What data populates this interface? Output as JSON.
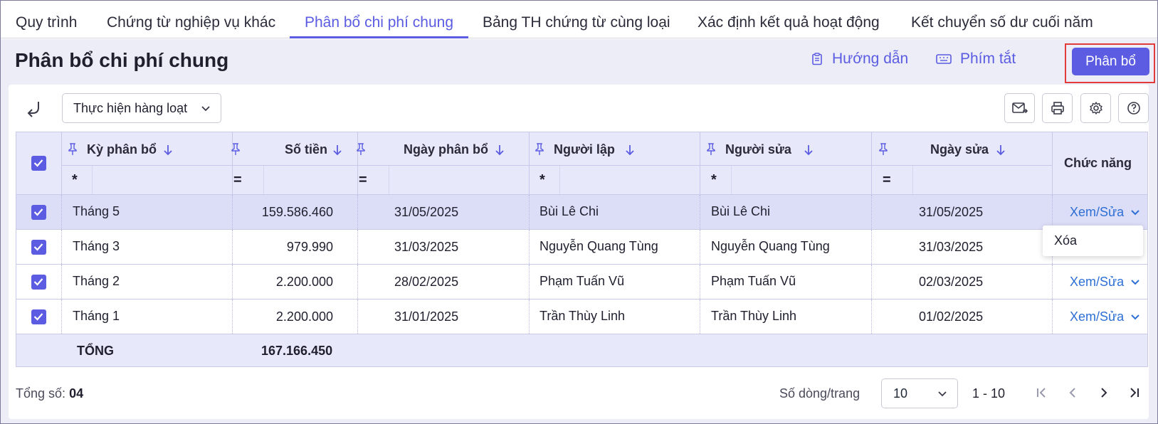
{
  "tabs": [
    {
      "label": "Quy trình",
      "active": false
    },
    {
      "label": "Chứng từ nghiệp vụ khác",
      "active": false
    },
    {
      "label": "Phân bổ chi phí chung",
      "active": true
    },
    {
      "label": "Bảng TH chứng từ cùng loại",
      "active": false
    },
    {
      "label": "Xác định kết quả hoạt động",
      "active": false
    },
    {
      "label": "Kết chuyển số dư cuối năm",
      "active": false
    }
  ],
  "header": {
    "title": "Phân bổ chi phí chung",
    "guide_label": "Hướng dẫn",
    "shortcut_label": "Phím tắt",
    "primary_label": "Phân bổ"
  },
  "toolbar": {
    "bulk_label": "Thực hiện hàng loạt"
  },
  "table": {
    "columns": [
      "Kỳ phân bổ",
      "Số tiền",
      "Ngày phân bổ",
      "Người lập",
      "Người sửa",
      "Ngày sửa",
      "Chức năng"
    ],
    "filter_ops": [
      "*",
      "=",
      "=",
      "*",
      "*",
      "="
    ],
    "rows": [
      {
        "period": "Tháng 5",
        "amount": "159.586.460",
        "alloc_date": "31/05/2025",
        "creator": "Bùi Lê Chi",
        "editor": "Bùi Lê Chi",
        "edit_date": "31/05/2025",
        "action": "Xem/Sửa",
        "checked": true,
        "selected": true
      },
      {
        "period": "Tháng 3",
        "amount": "979.990",
        "alloc_date": "31/03/2025",
        "creator": "Nguyễn Quang Tùng",
        "editor": "Nguyễn Quang Tùng",
        "edit_date": "31/03/2025",
        "action": "",
        "checked": true,
        "selected": false
      },
      {
        "period": "Tháng 2",
        "amount": "2.200.000",
        "alloc_date": "28/02/2025",
        "creator": "Phạm Tuấn Vũ",
        "editor": "Phạm Tuấn Vũ",
        "edit_date": "02/03/2025",
        "action": "Xem/Sửa",
        "checked": true,
        "selected": false
      },
      {
        "period": "Tháng 1",
        "amount": "2.200.000",
        "alloc_date": "31/01/2025",
        "creator": "Trần Thùy Linh",
        "editor": "Trần Thùy Linh",
        "edit_date": "01/02/2025",
        "action": "Xem/Sửa",
        "checked": true,
        "selected": false
      }
    ],
    "total_label": "TỔNG",
    "total_amount": "167.166.450"
  },
  "dropdown": {
    "delete_label": "Xóa"
  },
  "footer": {
    "total_label": "Tổng số:",
    "total_count": "04",
    "rows_per_page_label": "Số dòng/trang",
    "rows_per_page": "10",
    "range": "1 - 10"
  },
  "colors": {
    "accent": "#5b5ce2",
    "link": "#2d6fd6",
    "highlight_border": "#e33b3b",
    "header_bg": "#e7e8fa",
    "selected_row_bg": "#dcdef7"
  }
}
